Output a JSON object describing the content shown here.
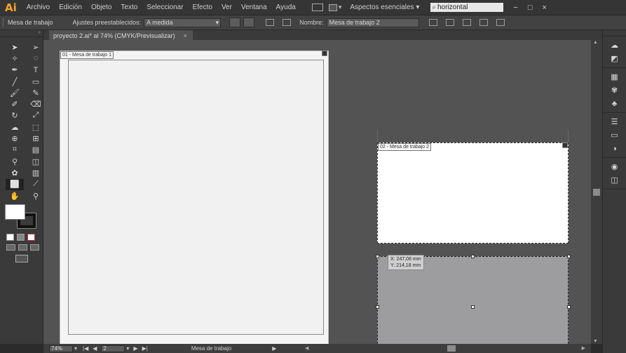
{
  "app": {
    "logo": "Ai"
  },
  "menu": {
    "items": [
      "Archivo",
      "Edición",
      "Objeto",
      "Texto",
      "Seleccionar",
      "Efecto",
      "Ver",
      "Ventana",
      "Ayuda"
    ],
    "workspace": "Aspectos esenciales ▾",
    "search_value": "horizontal",
    "window_controls": [
      "−",
      "□",
      "×"
    ]
  },
  "controlbar": {
    "panel_label": "Mesa de trabajo",
    "preset_label": "Ajustes preestablecidos:",
    "preset_value": "A medida",
    "name_label": "Nombre:",
    "name_value": "Mesa de trabajo 2"
  },
  "document": {
    "tab_title": "proyecto 2.ai* al 74% (CMYK/Previsualizar)",
    "tab_close": "×"
  },
  "artboards": [
    {
      "label": "01 - Mesa de trabajo 1"
    },
    {
      "label": "02 - Mesa de trabajo 2"
    }
  ],
  "readout": {
    "x": "X: 247,06 mm",
    "y": "Y: 214,18 mm"
  },
  "statusbar": {
    "zoom": "74%",
    "page": "2",
    "status_text": "Mesa de trabajo"
  },
  "icons": {
    "tools": [
      "selection-icon",
      "direct-selection-icon",
      "magic-wand-icon",
      "lasso-icon",
      "pen-icon",
      "type-icon",
      "line-icon",
      "rectangle-icon",
      "paintbrush-icon",
      "pencil-icon",
      "blob-brush-icon",
      "eraser-icon",
      "rotate-icon",
      "scale-icon",
      "warp-icon",
      "free-transform-icon",
      "shape-builder-icon",
      "perspective-grid-icon",
      "mesh-icon",
      "gradient-icon",
      "eyedropper-icon",
      "blend-icon",
      "symbol-sprayer-icon",
      "column-graph-icon",
      "artboard-icon",
      "slice-icon",
      "hand-icon",
      "zoom-icon"
    ]
  }
}
